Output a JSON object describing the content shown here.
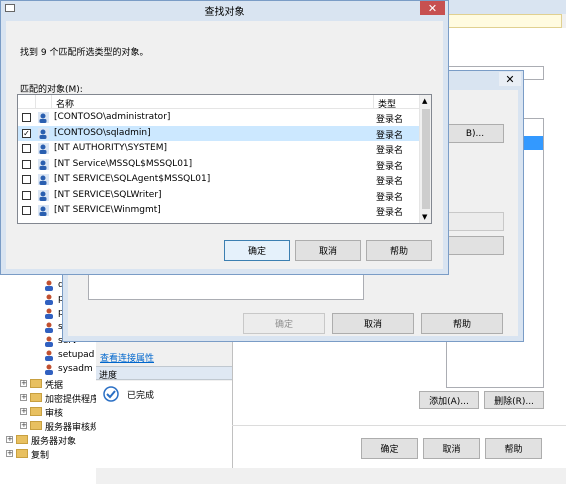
{
  "find_dialog": {
    "title": "查找对象",
    "found_text": "找到 9 个匹配所选类型的对象。",
    "matching_label": "匹配的对象(M):",
    "columns": {
      "name": "名称",
      "type": "类型"
    },
    "rows": [
      {
        "name": "[CONTOSO\\administrator]",
        "type": "登录名",
        "checked": false
      },
      {
        "name": "[CONTOSO\\sqladmin]",
        "type": "登录名",
        "checked": true
      },
      {
        "name": "[NT AUTHORITY\\SYSTEM]",
        "type": "登录名",
        "checked": false
      },
      {
        "name": "[NT Service\\MSSQL$MSSQL01]",
        "type": "登录名",
        "checked": false
      },
      {
        "name": "[NT SERVICE\\SQLAgent$MSSQL01]",
        "type": "登录名",
        "checked": false
      },
      {
        "name": "[NT SERVICE\\SQLWriter]",
        "type": "登录名",
        "checked": false
      },
      {
        "name": "[NT SERVICE\\Winmgmt]",
        "type": "登录名",
        "checked": false
      }
    ],
    "buttons": {
      "ok": "确定",
      "cancel": "取消",
      "help": "帮助"
    }
  },
  "select_dialog": {
    "browse_fragment": "B)...",
    "buttons": {
      "ok": "确定",
      "cancel": "取消",
      "help": "帮助"
    }
  },
  "tree": {
    "items": [
      "disk",
      "pro",
      "pub",
      "secu",
      "serv",
      "setupad",
      "sysadm"
    ],
    "folders": [
      "凭据",
      "加密提供程序",
      "审核",
      "服务器审核规"
    ],
    "server_objects": "服务器对象",
    "replication": "复制"
  },
  "connection_link": "查看连接属性",
  "progress": {
    "header": "进度",
    "status": "已完成"
  },
  "bg_dialog": {
    "add_button": "添加(A)...",
    "remove_button": "删除(R)...",
    "ok": "确定",
    "cancel": "取消",
    "help": "帮助"
  }
}
